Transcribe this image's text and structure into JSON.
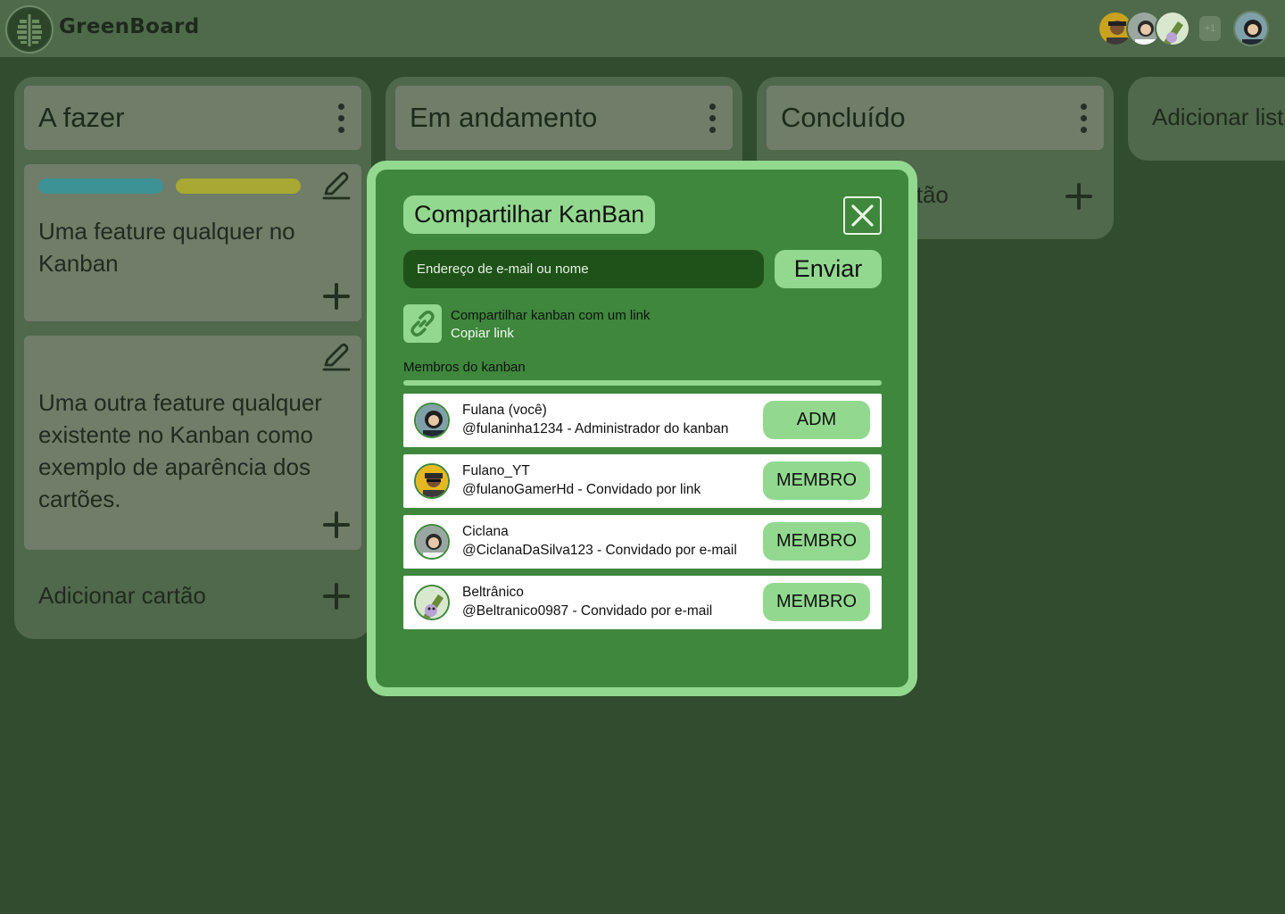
{
  "app": {
    "title": "GreenBoard"
  },
  "header": {
    "more_members": "+1"
  },
  "columns": [
    {
      "title": "A fazer",
      "cards": [
        {
          "text": "Uma feature qualquer no Kanban",
          "tags": [
            "#3d9296",
            "#a8a832"
          ]
        },
        {
          "text": "Uma outra feature qualquer existente no Kanban como exemplo de aparência dos cartões."
        }
      ],
      "add_card": "Adicionar cartão"
    },
    {
      "title": "Em andamento"
    },
    {
      "title": "Concluído",
      "add_card": "Adicionar cartão"
    }
  ],
  "add_list": "Adicionar lista",
  "share_modal": {
    "title": "Compartilhar KanBan",
    "email_placeholder": "Endereço de e-mail ou nome",
    "send_label": "Enviar",
    "share_link_text": "Compartilhar kanban com um link",
    "copy_link": "Copiar link",
    "members_label": "Membros do kanban",
    "members": [
      {
        "name": "Fulana (você)",
        "sub": "@fulaninha1234 - Administrador do kanban",
        "role": "ADM"
      },
      {
        "name": "Fulano_YT",
        "sub": "@fulanoGamerHd - Convidado por link",
        "role": "MEMBRO"
      },
      {
        "name": "Ciclana",
        "sub": "@CiclanaDaSilva123 - Convidado por e-mail",
        "role": "MEMBRO"
      },
      {
        "name": "Beltrânico",
        "sub": "@Beltranico0987 - Convidado por e-mail",
        "role": "MEMBRO"
      }
    ]
  },
  "colors": {
    "accent": "#92d98f",
    "modal_bg": "#3e873c",
    "background": "#314c2e"
  }
}
